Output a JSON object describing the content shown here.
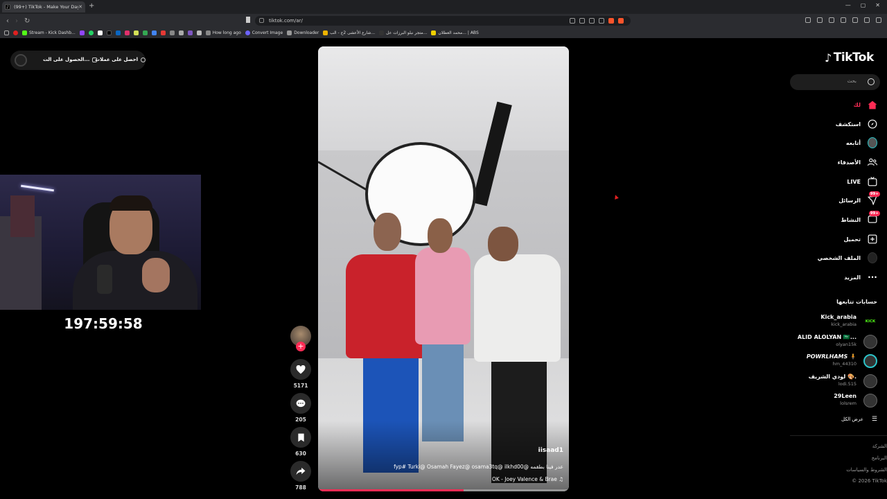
{
  "browser": {
    "tab_title": "(99+) TikTok - Make Your Day",
    "url": "tiktok.com/ar/",
    "bookmarks": [
      {
        "label": "Stream - Kick Dashb...",
        "color": "#53fc18"
      },
      {
        "label": "How long ago",
        "color": "#888888"
      },
      {
        "label": "Convert Image",
        "color": "#6c63ff"
      },
      {
        "label": "Downloader",
        "color": "#999999"
      },
      {
        "label": "شارع الأعشى 2ج - الب...",
        "color": "#f0b400"
      },
      {
        "label": "متجر نبلو البرزات عل...",
        "color": "#999999"
      },
      {
        "label": "محمد العطلان... | ABS",
        "color": "#f0d000"
      }
    ]
  },
  "overlay": {
    "promo_item_1": "الحصول على الت...",
    "promo_item_2": "احصل على عملات",
    "timer": "197:59:58"
  },
  "video": {
    "username": "iisaad1",
    "caption": "fyp# Turki@ Osamah Fayez@ osama3tq@ ilkhd00@ عدر فينا بطقمه",
    "music": "OK - Joey Valence & Brae ♫",
    "progress": 0.58
  },
  "actions": {
    "likes": "5171",
    "comments": "205",
    "saves": "630",
    "shares": "788"
  },
  "sidebar": {
    "logo": "TikTok",
    "search_placeholder": "بحث",
    "nav": [
      {
        "label": "لك",
        "icon": "home-icon"
      },
      {
        "label": "استكشف",
        "icon": "compass-icon"
      },
      {
        "label": "أتابعه",
        "icon": "following-avatar-icon"
      },
      {
        "label": "الأصدقاء",
        "icon": "friends-icon"
      },
      {
        "label": "LIVE",
        "icon": "live-icon"
      },
      {
        "label": "الرسائل",
        "icon": "messages-icon",
        "badge": "99+"
      },
      {
        "label": "النشاط",
        "icon": "activity-icon",
        "badge": "99+"
      },
      {
        "label": "تحميل",
        "icon": "upload-icon"
      },
      {
        "label": "الملف الشخصي",
        "icon": "profile-icon"
      },
      {
        "label": "المزيد",
        "icon": "more-icon"
      }
    ],
    "following_title": "حسابات تتابعها",
    "following": [
      {
        "name": "Kick_arabia",
        "handle": "kick_arabia"
      },
      {
        "name": "ALID ALOLYAN 🇸🇦...",
        "handle": "olyan15k"
      },
      {
        "name": "𝙋𝙊𝙒𝙍𝙇𝙃𝘼𝙈𝙎 🧍",
        "handle": "hm_44310"
      },
      {
        "name": "لودي الشريف 🎨.",
        "handle": "lodi.515"
      },
      {
        "name": "29Leen",
        "handle": "lolsrem"
      }
    ],
    "see_all": "عرض الكل",
    "footer": [
      "الشركة",
      "البرنامج",
      "الشروط والسياسات",
      "© 2026 TikTok"
    ]
  }
}
